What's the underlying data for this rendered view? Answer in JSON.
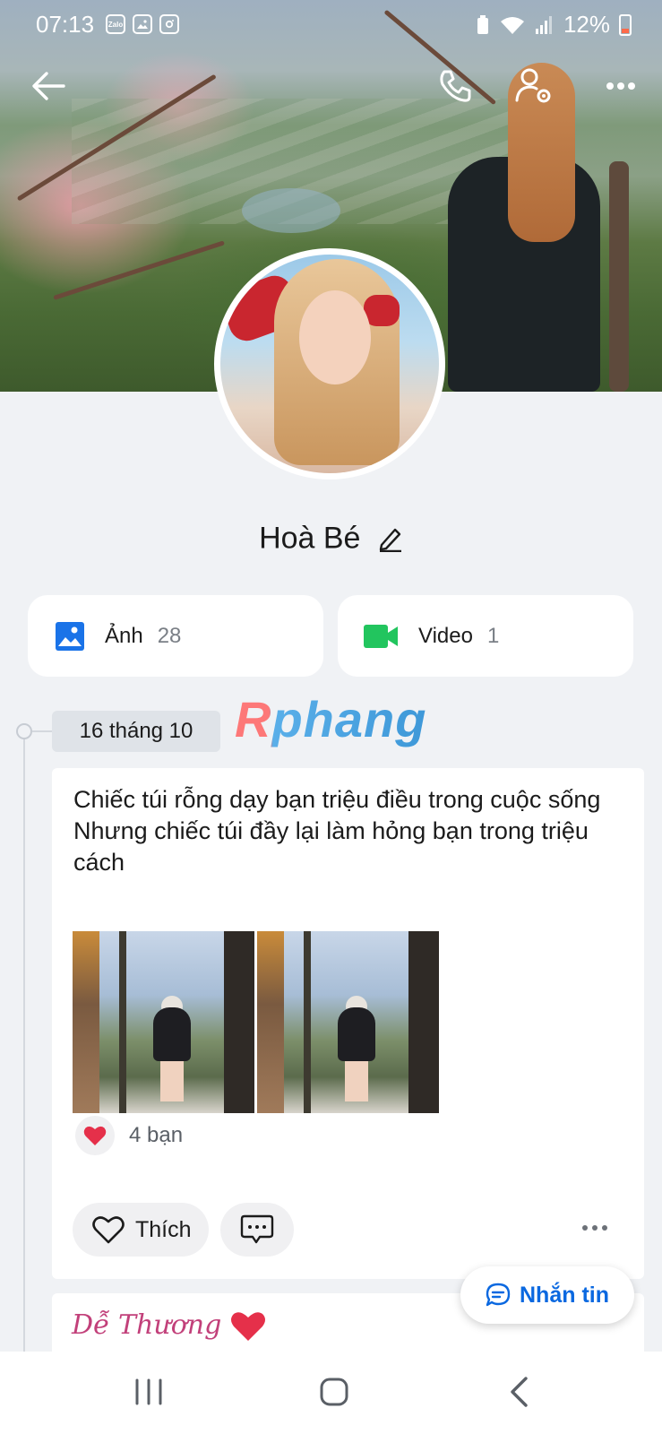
{
  "status_bar": {
    "time": "07:13",
    "app_icons": [
      "zalo-icon",
      "gallery-icon",
      "instagram-icon"
    ],
    "zalo_label": "Zalo",
    "battery": "12%"
  },
  "header_icons": [
    "back-arrow-icon",
    "phone-icon",
    "user-settings-icon",
    "more-icon"
  ],
  "profile": {
    "name": "Hoà Bé"
  },
  "media": {
    "photos": {
      "label": "Ảnh",
      "count": "28",
      "icon": "image-icon",
      "color": "#1a73e8"
    },
    "videos": {
      "label": "Video",
      "count": "1",
      "icon": "video-camera-icon",
      "color": "#22c55e"
    }
  },
  "watermark": "Rphang",
  "timeline": {
    "date": "16 tháng 10"
  },
  "post": {
    "text_line1": "Chiếc túi rỗng dạy bạn triệu điều trong cuộc sống",
    "text_line2": "Nhưng chiếc túi đầy lại làm hỏng bạn trong triệu cách",
    "photo_count": 2,
    "reaction_count": "4 bạn",
    "like_label": "Thích"
  },
  "next_post": {
    "text": "Dễ Thương"
  },
  "message_button": "Nhắn tin",
  "colors": {
    "accent": "#0a68e0",
    "heart": "#e5304a",
    "background": "#f0f2f5"
  }
}
